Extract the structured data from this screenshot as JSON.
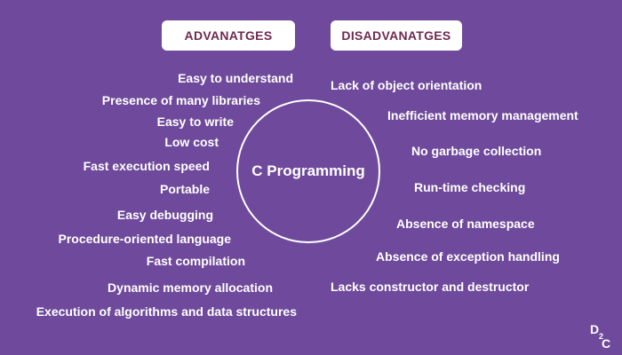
{
  "headers": {
    "advantages": "ADVANATGES",
    "disadvantages": "DISADVANATGES"
  },
  "center": {
    "label": "C Programming"
  },
  "advantages": [
    "Easy to understand",
    "Presence of many libraries",
    "Easy to write",
    "Low cost",
    "Fast execution speed",
    "Portable",
    "Easy debugging",
    "Procedure-oriented language",
    "Fast compilation",
    "Dynamic memory allocation",
    "Execution of algorithms and data structures"
  ],
  "disadvantages": [
    "Lack of object orientation",
    "Inefficient memory management",
    "No garbage collection",
    "Run-time checking",
    "Absence of namespace",
    "Absence of exception handling",
    "Lacks constructor and destructor"
  ],
  "logo": {
    "text": "D2C"
  },
  "colors": {
    "background": "#6f4a9c",
    "header_text": "#6f2a52",
    "text": "#ffffff"
  }
}
